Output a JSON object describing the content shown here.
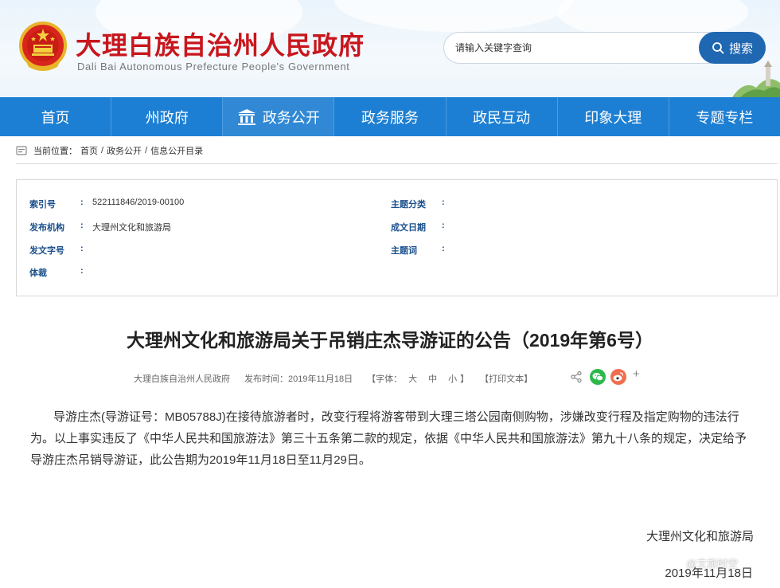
{
  "header": {
    "title": "大理白族自治州人民政府",
    "subtitle": "Dali Bai Autonomous Prefecture People's Government",
    "search_placeholder": "请输入关键字查询",
    "search_button": "搜索"
  },
  "nav": {
    "items": [
      "首页",
      "州政府",
      "政务公开",
      "政务服务",
      "政民互动",
      "印象大理",
      "专题专栏"
    ],
    "active": "政务公开"
  },
  "breadcrumb": {
    "prefix": "当前位置：",
    "items": [
      "首页",
      "政务公开",
      "信息公开目录"
    ],
    "separator": "/"
  },
  "info": {
    "index_label": "索引号",
    "index_value": "522111846/2019-00100",
    "topic_label": "主题分类",
    "topic_value": "",
    "issuer_label": "发布机构",
    "issuer_value": "大理州文化和旅游局",
    "date_label": "成文日期",
    "date_value": "",
    "docno_label": "发文字号",
    "docno_value": "",
    "keyword_label": "主题词",
    "keyword_value": "",
    "genre_label": "体裁",
    "genre_value": "",
    "colon": ":"
  },
  "article": {
    "title": "大理州文化和旅游局关于吊销庄杰导游证的公告（2019年第6号）",
    "source": "大理白族自治州人民政府",
    "publish_label": "发布时间：",
    "publish_date": "2019年11月18日",
    "font_label": "【字体：",
    "font_large": "大",
    "font_medium": "中",
    "font_small": "小",
    "font_close": "】",
    "print_label": "【打印文本】",
    "plus": "+",
    "body": "导游庄杰(导游证号：MB05788J)在接待旅游者时，改变行程将游客带到大理三塔公园南侧购物，涉嫌改变行程及指定购物的违法行为。以上事实违反了《中华人民共和国旅游法》第三十五条第二款的规定，依据《中华人民共和国旅游法》第九十八条的规定，决定给予导游庄杰吊销导游证，此公告期为2019年11月18日至11月29日。",
    "sign_org": "大理州文化和旅游局",
    "sign_date": "2019年11月18日",
    "watermark": "@文旅时空"
  },
  "colors": {
    "nav_bg": "#1d7fd3",
    "title_red": "#c8161d",
    "label_blue": "#1a4f8b",
    "search_btn": "#1f67b1"
  }
}
